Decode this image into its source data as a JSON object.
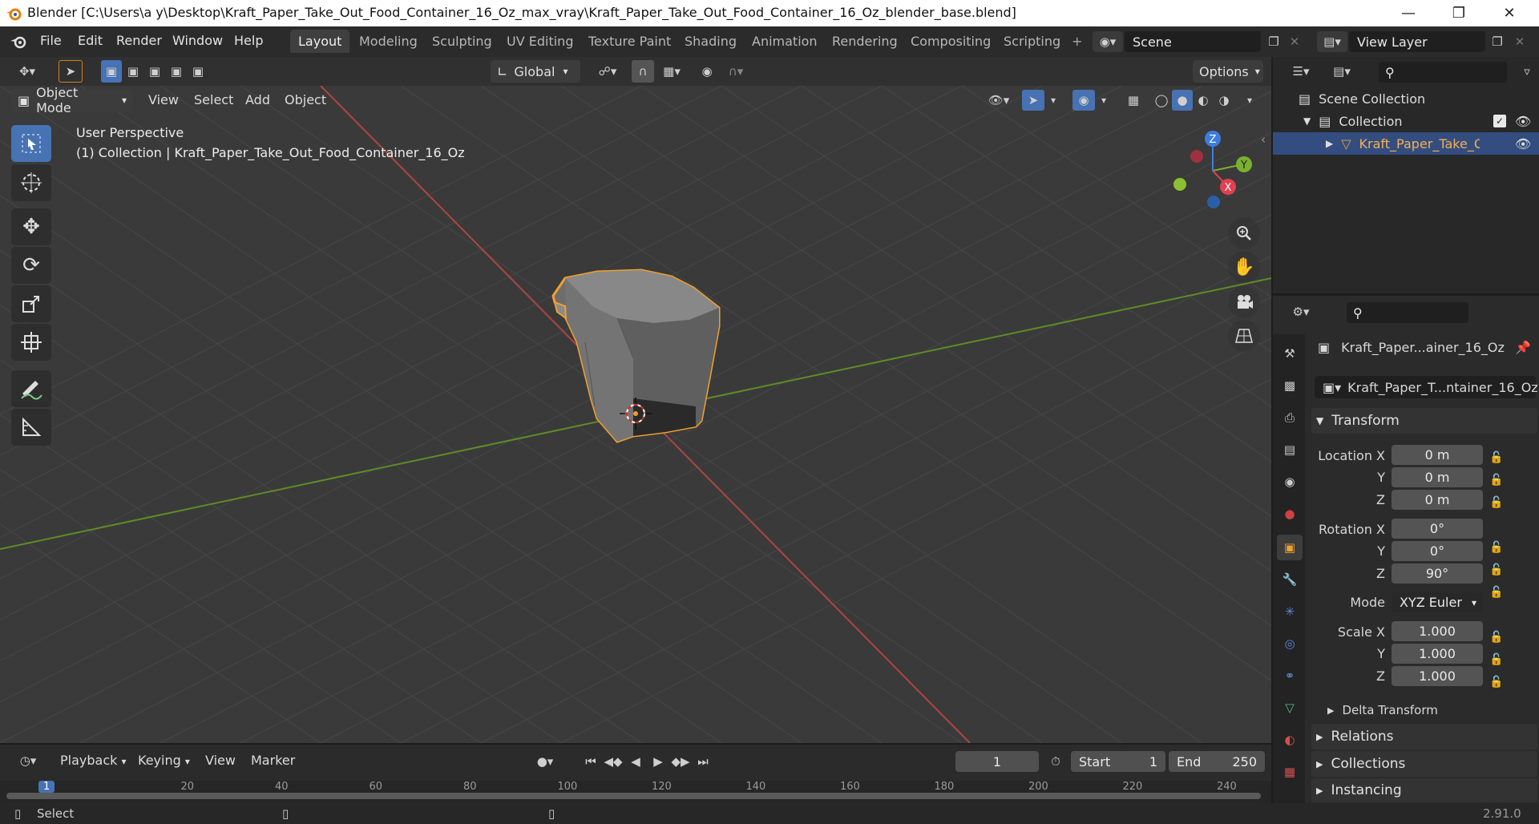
{
  "window": {
    "title": "Blender [C:\\Users\\a y\\Desktop\\Kraft_Paper_Take_Out_Food_Container_16_Oz_max_vray\\Kraft_Paper_Take_Out_Food_Container_16_Oz_blender_base.blend]"
  },
  "menu": {
    "file": "File",
    "edit": "Edit",
    "render": "Render",
    "window": "Window",
    "help": "Help"
  },
  "workspaces": [
    "Layout",
    "Modeling",
    "Sculpting",
    "UV Editing",
    "Texture Paint",
    "Shading",
    "Animation",
    "Rendering",
    "Compositing",
    "Scripting"
  ],
  "add_workspace": "+",
  "scene": {
    "name": "Scene"
  },
  "view_layer": {
    "name": "View Layer"
  },
  "header": {
    "orientation": "Global",
    "options": "Options",
    "mode": "Object Mode",
    "view": "View",
    "select": "Select",
    "add": "Add",
    "object": "Object"
  },
  "viewport": {
    "perspective": "User Perspective",
    "collection_label": "(1) Collection | Kraft_Paper_Take_Out_Food_Container_16_Oz",
    "gizmo": {
      "x": "X",
      "y": "Y",
      "z": "Z"
    }
  },
  "outliner": {
    "scene_collection": "Scene Collection",
    "collection": "Collection",
    "object": "Kraft_Paper_Take_Ou"
  },
  "properties": {
    "object_name": "Kraft_Paper...ainer_16_Oz",
    "mesh_name": "Kraft_Paper_T...ntainer_16_Oz",
    "transform": "Transform",
    "location": {
      "label_x": "Location X",
      "x": "0 m",
      "y": "0 m",
      "z": "0 m"
    },
    "rotation": {
      "label_x": "Rotation X",
      "x": "0°",
      "y": "0°",
      "z": "90°"
    },
    "axis_y": "Y",
    "axis_z": "Z",
    "mode_label": "Mode",
    "mode_value": "XYZ Euler",
    "scale": {
      "label_x": "Scale X",
      "x": "1.000",
      "y": "1.000",
      "z": "1.000"
    },
    "delta_transform": "Delta Transform",
    "relations": "Relations",
    "collections": "Collections",
    "instancing": "Instancing"
  },
  "timeline": {
    "playback": "Playback",
    "keying": "Keying",
    "view": "View",
    "marker": "Marker",
    "current_frame": "1",
    "start_label": "Start",
    "start": "1",
    "end_label": "End",
    "end": "250",
    "ruler": [
      "1",
      "20",
      "40",
      "60",
      "80",
      "100",
      "120",
      "140",
      "160",
      "180",
      "200",
      "220",
      "240"
    ]
  },
  "status": {
    "select": "Select",
    "version": "2.91.0"
  },
  "colors": {
    "accent": "#4772b3",
    "selection": "#f0a030",
    "x_axis": "#c94949",
    "y_axis": "#6a9a2a"
  }
}
